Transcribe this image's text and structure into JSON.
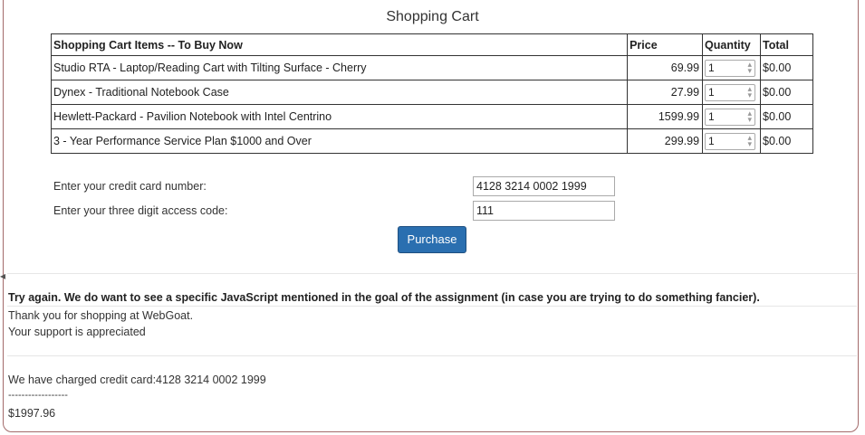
{
  "page": {
    "title": "Shopping Cart"
  },
  "cart": {
    "headers": {
      "item": "Shopping Cart Items -- To Buy Now",
      "price": "Price",
      "quantity": "Quantity",
      "total": "Total"
    },
    "rows": [
      {
        "item": "Studio RTA - Laptop/Reading Cart with Tilting Surface - Cherry",
        "price": "69.99",
        "quantity": "1",
        "total": "$0.00"
      },
      {
        "item": "Dynex - Traditional Notebook Case",
        "price": "27.99",
        "quantity": "1",
        "total": "$0.00"
      },
      {
        "item": "Hewlett-Packard - Pavilion Notebook with Intel Centrino",
        "price": "1599.99",
        "quantity": "1",
        "total": "$0.00"
      },
      {
        "item": "3 - Year Performance Service Plan $1000 and Over",
        "price": "299.99",
        "quantity": "1",
        "total": "$0.00"
      }
    ]
  },
  "form": {
    "credit_label": "Enter your credit card number:",
    "credit_value": "4128 3214 0002 1999",
    "code_label": "Enter your three digit access code:",
    "code_value": "111",
    "purchase_label": "Purchase"
  },
  "messages": {
    "feedback": "Try again. We do want to see a specific JavaScript mentioned in the goal of the assignment (in case you are trying to do something fancier).",
    "thanks": "Thank you for shopping at WebGoat.",
    "support": "Your support is appreciated",
    "charged": "We have charged credit card:4128 3214 0002 1999",
    "separator": "------------------",
    "amount": "$1997.96"
  },
  "colors": {
    "button": "#2a6fb0",
    "panel_border": "#a36b6b"
  }
}
